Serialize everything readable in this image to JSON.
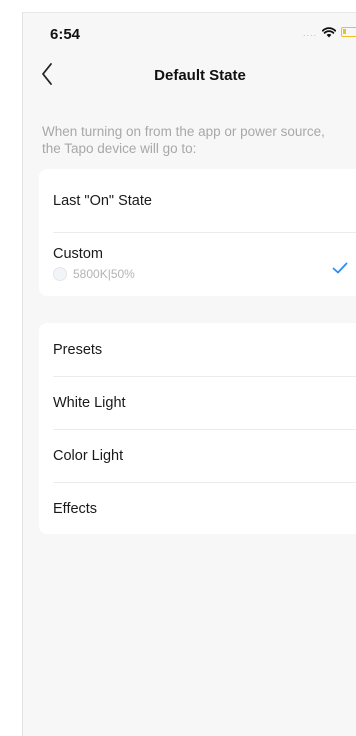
{
  "status_bar": {
    "time": "6:54",
    "signal": "....",
    "icons": [
      "wifi-icon",
      "battery-icon"
    ]
  },
  "nav": {
    "title": "Default State",
    "back_icon": "chevron-left-icon"
  },
  "description": "When turning on from the app or power source, the Tapo device will go to:",
  "state_options": [
    {
      "label": "Last \"On\" State",
      "selected": false
    },
    {
      "label": "Custom",
      "detail": "5800K|50%",
      "selected": true
    }
  ],
  "mode_options": [
    {
      "label": "Presets"
    },
    {
      "label": "White Light"
    },
    {
      "label": "Color Light"
    },
    {
      "label": "Effects"
    }
  ],
  "colors": {
    "accent": "#2f8cf5",
    "background": "#f7f7f7",
    "card": "#ffffff",
    "secondary_text": "#a8a8a8"
  }
}
